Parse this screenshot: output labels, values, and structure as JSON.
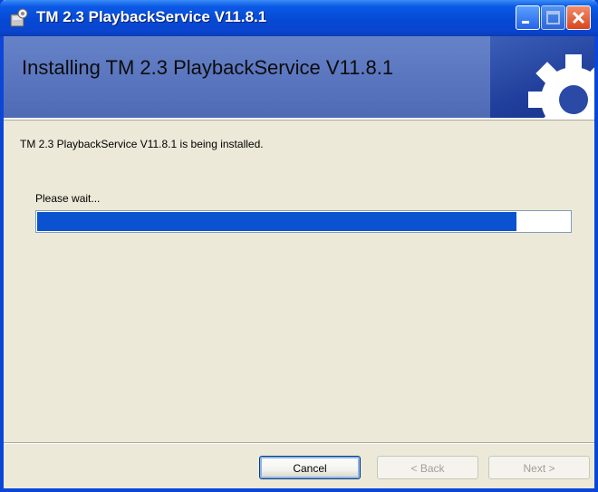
{
  "window": {
    "title": "TM 2.3 PlaybackService V11.8.1",
    "accent_color": "#0a46d8"
  },
  "banner": {
    "heading": "Installing TM 2.3 PlaybackService V11.8.1",
    "art_icon": "gear-icon"
  },
  "main": {
    "status_text": "TM 2.3 PlaybackService V11.8.1 is being installed.",
    "wait_label": "Please wait...",
    "progress": 0.9
  },
  "buttons": {
    "cancel": "Cancel",
    "back": "< Back",
    "next": "Next >"
  },
  "caption_buttons": {
    "minimize": "minimize-icon",
    "maximize": "maximize-icon",
    "close": "close-icon"
  }
}
